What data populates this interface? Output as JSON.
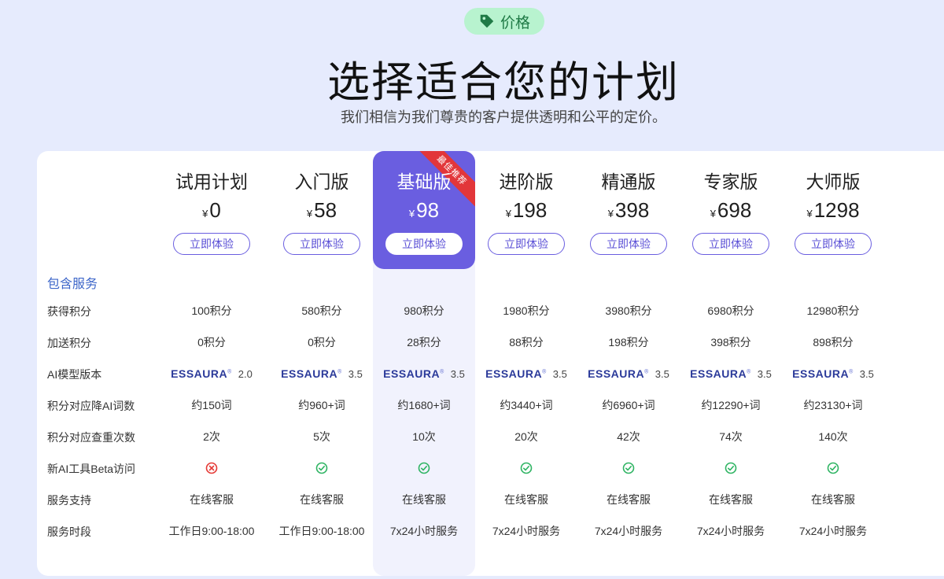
{
  "badge": {
    "label": "价格",
    "icon": "tag-icon"
  },
  "header": {
    "title": "选择适合您的计划",
    "subtitle": "我们相信为我们尊贵的客户提供透明和公平的定价。"
  },
  "recommended_ribbon": "最佳推荐",
  "currency": "¥",
  "plans": [
    {
      "name": "试用计划",
      "price": "0",
      "button": "立即体验"
    },
    {
      "name": "入门版",
      "price": "58",
      "button": "立即体验"
    },
    {
      "name": "基础版",
      "price": "98",
      "button": "立即体验",
      "recommended": true
    },
    {
      "name": "进阶版",
      "price": "198",
      "button": "立即体验"
    },
    {
      "name": "精通版",
      "price": "398",
      "button": "立即体验"
    },
    {
      "name": "专家版",
      "price": "698",
      "button": "立即体验"
    },
    {
      "name": "大师版",
      "price": "1298",
      "button": "立即体验"
    }
  ],
  "section_label": "包含服务",
  "model_logo": "ESSAURA",
  "rows": [
    {
      "label": "获得积分",
      "values": [
        "100积分",
        "580积分",
        "980积分",
        "1980积分",
        "3980积分",
        "6980积分",
        "12980积分"
      ]
    },
    {
      "label": "加送积分",
      "values": [
        "0积分",
        "0积分",
        "28积分",
        "88积分",
        "198积分",
        "398积分",
        "898积分"
      ]
    },
    {
      "label": "AI模型版本",
      "values": [
        "2.0",
        "3.5",
        "3.5",
        "3.5",
        "3.5",
        "3.5",
        "3.5"
      ]
    },
    {
      "label": "积分对应降AI词数",
      "values": [
        "约150词",
        "约960+词",
        "约1680+词",
        "约3440+词",
        "约6960+词",
        "约12290+词",
        "约23130+词"
      ]
    },
    {
      "label": "积分对应查重次数",
      "values": [
        "2次",
        "5次",
        "10次",
        "20次",
        "42次",
        "74次",
        "140次"
      ]
    },
    {
      "label": "新AI工具Beta访问",
      "values": [
        false,
        true,
        true,
        true,
        true,
        true,
        true
      ]
    },
    {
      "label": "服务支持",
      "values": [
        "在线客服",
        "在线客服",
        "在线客服",
        "在线客服",
        "在线客服",
        "在线客服",
        "在线客服"
      ]
    },
    {
      "label": "服务时段",
      "values": [
        "工作日9:00-18:00",
        "工作日9:00-18:00",
        "7x24小时服务",
        "7x24小时服务",
        "7x24小时服务",
        "7x24小时服务",
        "7x24小时服务"
      ]
    }
  ],
  "colors": {
    "accent": "#6a5ee0",
    "check": "#2fb463",
    "cross": "#e53935",
    "ribbon": "#e2363a"
  }
}
